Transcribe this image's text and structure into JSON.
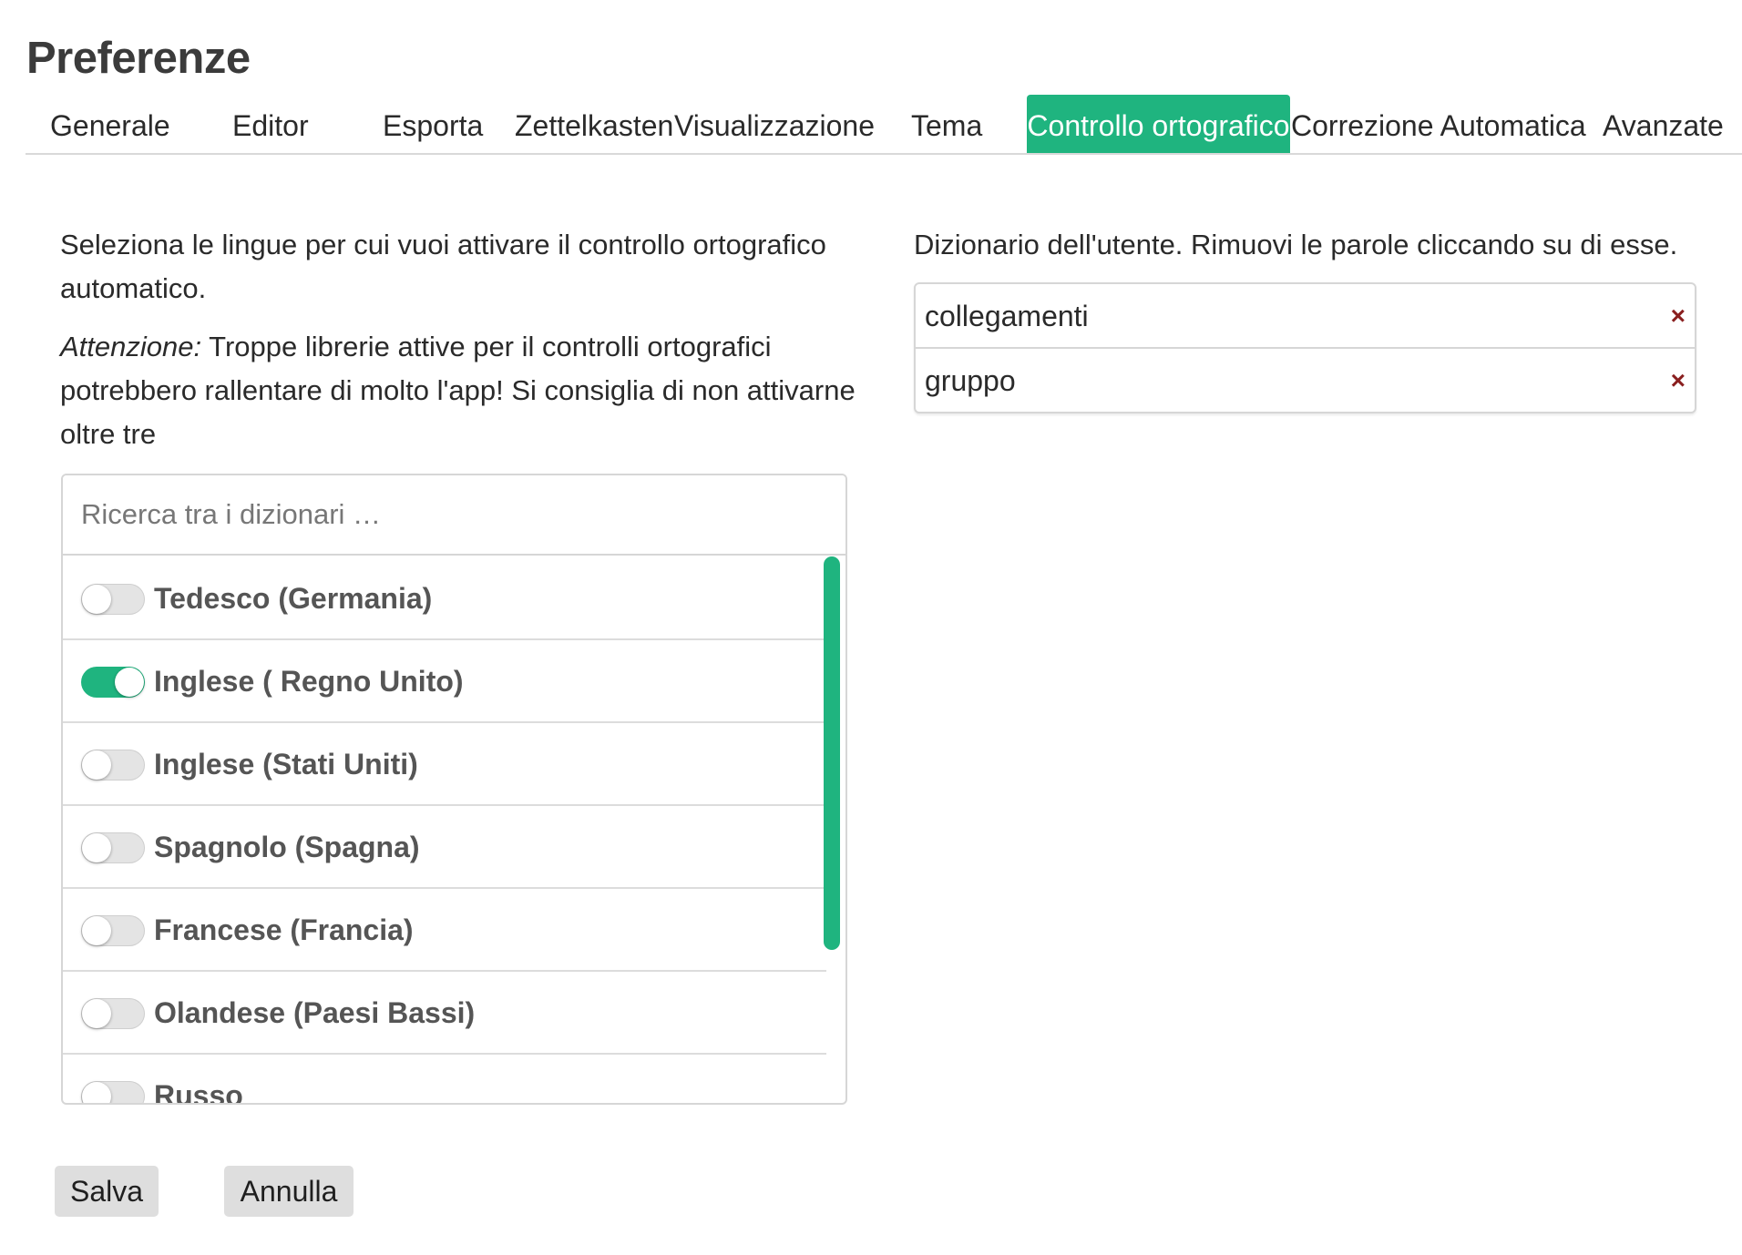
{
  "page": {
    "title": "Preferenze"
  },
  "tabs": [
    {
      "label": "Generale",
      "active": false
    },
    {
      "label": "Editor",
      "active": false
    },
    {
      "label": "Esporta",
      "active": false
    },
    {
      "label": "Zettelkasten",
      "active": false
    },
    {
      "label": "Visualizzazione",
      "active": false
    },
    {
      "label": "Tema",
      "active": false
    },
    {
      "label": "Controllo ortografico",
      "active": true
    },
    {
      "label": "Correzione Automatica",
      "active": false
    },
    {
      "label": "Avanzate",
      "active": false
    }
  ],
  "spellcheck": {
    "intro": "Seleziona le lingue per cui vuoi attivare il controllo ortografico automatico.",
    "warning_label": "Attenzione:",
    "warning_text": " Troppe librerie attive per il controlli ortografici potrebbero rallentare di molto l'app! Si consiglia di non attivarne oltre tre",
    "search_placeholder": "Ricerca tra i dizionari …",
    "dictionaries": [
      {
        "label": "Tedesco (Germania)",
        "enabled": false
      },
      {
        "label": "Inglese ( Regno Unito)",
        "enabled": true
      },
      {
        "label": "Inglese (Stati Uniti)",
        "enabled": false
      },
      {
        "label": "Spagnolo (Spagna)",
        "enabled": false
      },
      {
        "label": "Francese (Francia)",
        "enabled": false
      },
      {
        "label": "Olandese (Paesi Bassi)",
        "enabled": false
      },
      {
        "label": "Russo",
        "enabled": false
      }
    ]
  },
  "user_dictionary": {
    "caption": "Dizionario dell'utente. Rimuovi le parole cliccando su di esse.",
    "remove_symbol": "×",
    "words": [
      "collegamenti",
      "gruppo"
    ]
  },
  "buttons": {
    "save": "Salva",
    "cancel": "Annulla"
  },
  "colors": {
    "accent": "#1fb47f",
    "remove": "#8a1f1f"
  }
}
